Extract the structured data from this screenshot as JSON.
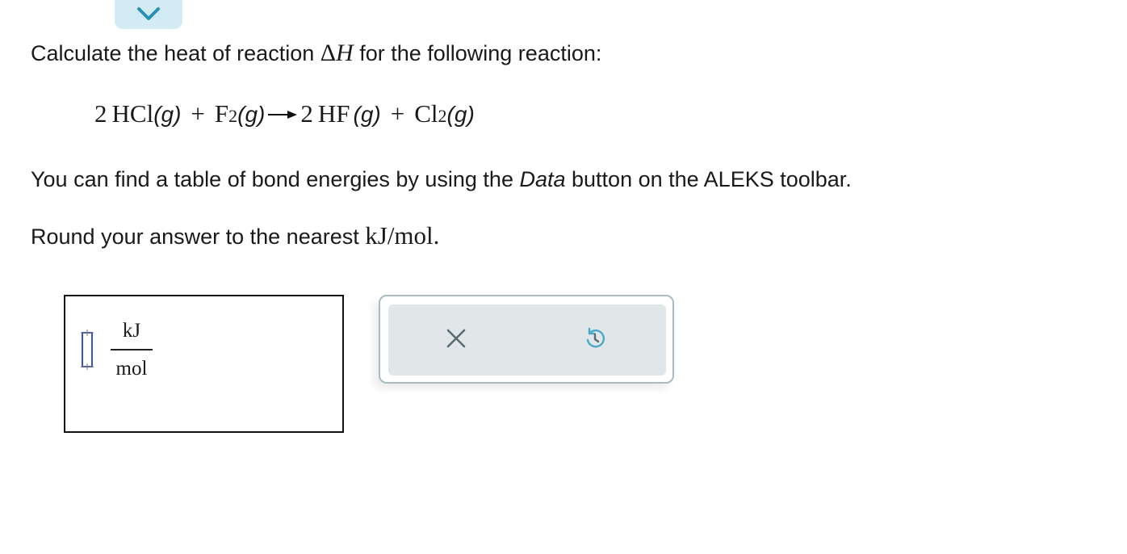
{
  "header": {
    "collapse_icon": "chevron-down-icon",
    "accent_color": "#d3ecf3",
    "chevron_color": "#2a8fb5"
  },
  "question": {
    "prefix": "Calculate the heat of reaction ",
    "delta": "Δ",
    "variable": "H",
    "suffix": " for the following reaction:"
  },
  "equation": {
    "reactant1_coef": "2",
    "reactant1": "HCl",
    "reactant1_phase": "(g)",
    "plus1": "+",
    "reactant2": "F",
    "reactant2_sub": "2",
    "reactant2_phase": "(g)",
    "product1_coef": "2",
    "product1": "HF",
    "product1_phase": "(g)",
    "plus2": "+",
    "product2": "Cl",
    "product2_sub": "2",
    "product2_phase": "(g)"
  },
  "hint": {
    "prefix": "You can find a table of bond energies by using the ",
    "data_word": "Data",
    "suffix": " button on the ALEKS toolbar."
  },
  "rounding": {
    "prefix": "Round your answer to the nearest ",
    "unit": "kJ/mol",
    "suffix": "."
  },
  "answer": {
    "value": "",
    "unit_numerator": "kJ",
    "unit_denominator": "mol",
    "input_color": "#3b50d6"
  },
  "tools": {
    "clear_icon": "x-icon",
    "undo_icon": "undo-icon",
    "icon_color": "#5a6b73"
  }
}
